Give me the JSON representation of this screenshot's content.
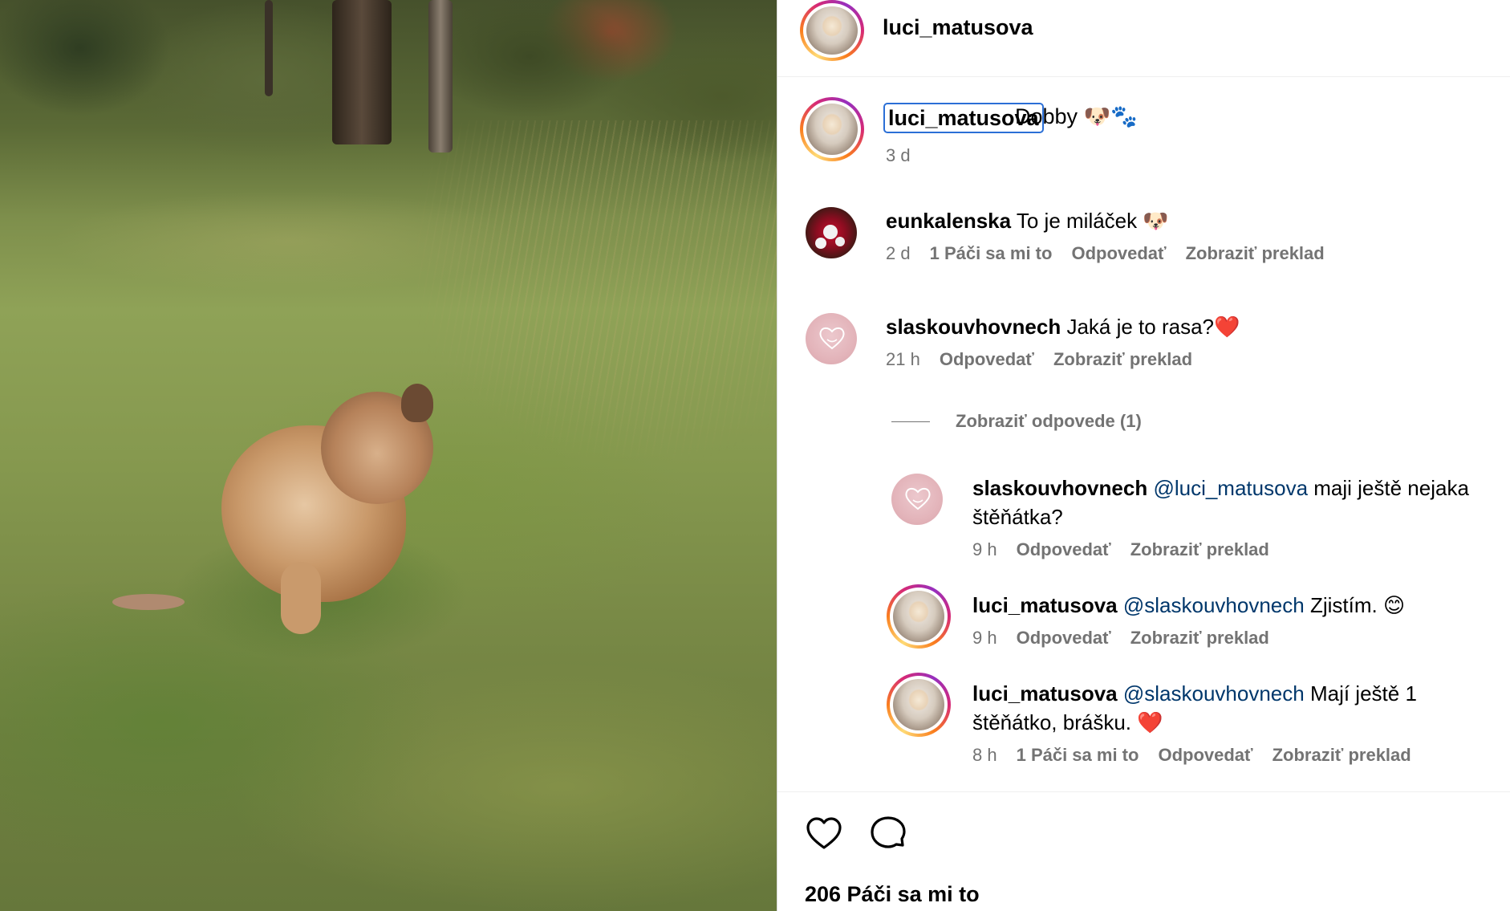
{
  "post": {
    "author": "luci_matusova",
    "caption_text": "Dobby 🐶🐾",
    "caption_age": "3 d",
    "likes_label": "206 Páči sa mi to"
  },
  "comments": [
    {
      "user": "eunkalenska",
      "text": "To je miláček 🐶",
      "age": "2 d",
      "likes": "1 Páči sa mi to",
      "reply": "Odpovedať",
      "translate": "Zobraziť preklad"
    },
    {
      "user": "slaskouvhovnech",
      "text": "Jaká je to rasa?❤️",
      "age": "21 h",
      "reply": "Odpovedať",
      "translate": "Zobraziť preklad",
      "replies_toggle": "Zobraziť odpovede (1)"
    }
  ],
  "replies": [
    {
      "user": "slaskouvhovnech",
      "mention": "@luci_matusova",
      "text": "maji ještě nejaka",
      "text_line2": "štěňátka?",
      "age": "9 h",
      "reply": "Odpovedať",
      "translate": "Zobraziť preklad"
    },
    {
      "user": "luci_matusova",
      "mention": "@slaskouvhovnech",
      "text": "Zjistím. 😊",
      "age": "9 h",
      "reply": "Odpovedať",
      "translate": "Zobraziť preklad"
    },
    {
      "user": "luci_matusova",
      "mention": "@slaskouvhovnech",
      "text": "Mají ještě 1",
      "text_line2": "štěňátko, brášku. ❤️",
      "age": "8 h",
      "likes": "1 Páči sa mi to",
      "reply": "Odpovedať",
      "translate": "Zobraziť preklad"
    }
  ],
  "icons": {
    "like": "heart-outline-icon",
    "comment": "speech-bubble-icon"
  },
  "colors": {
    "mention": "#00376b",
    "meta": "#737373",
    "focus_outline": "#2b6fd6",
    "story_ring": [
      "#feda75",
      "#fa7e1e",
      "#d62976",
      "#962fbf"
    ]
  }
}
